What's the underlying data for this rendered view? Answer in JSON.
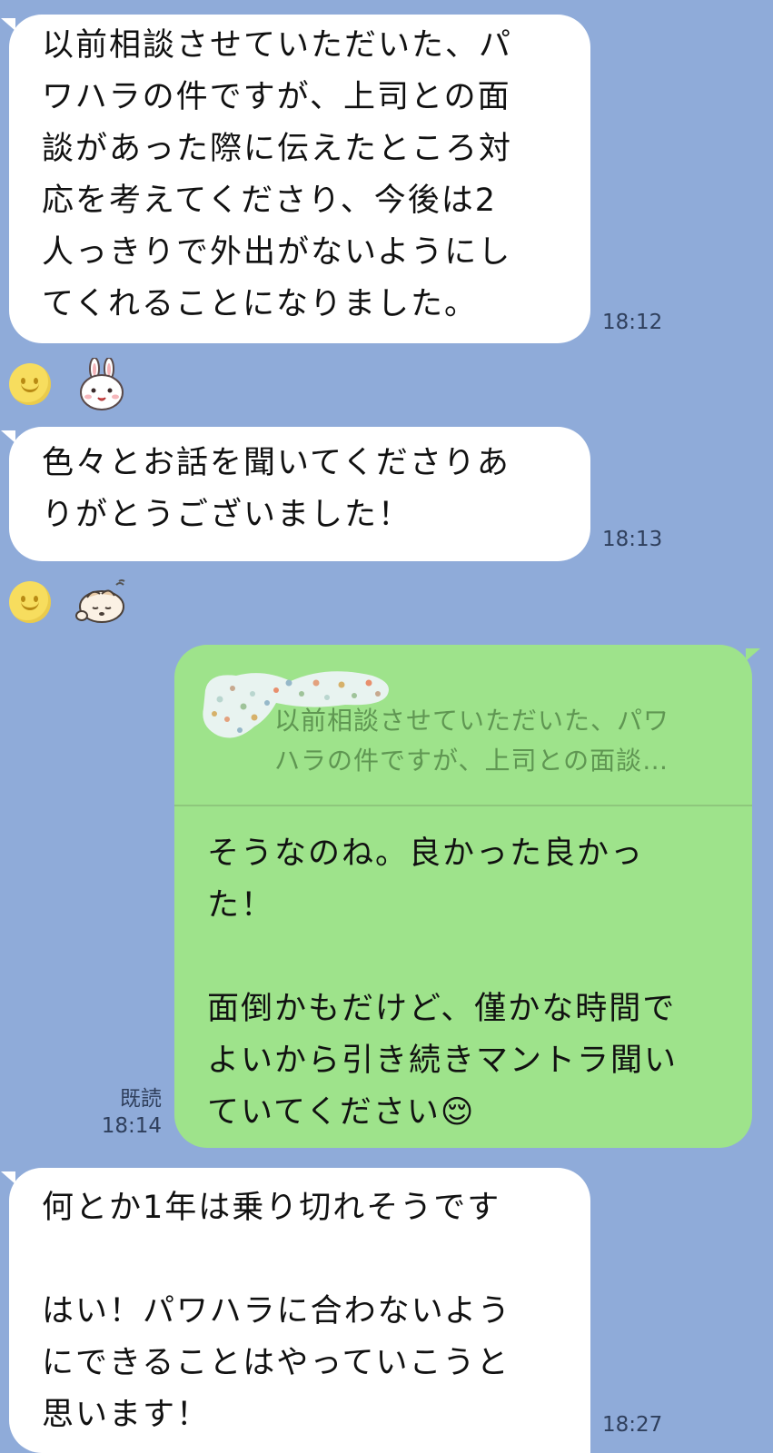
{
  "messages": [
    {
      "side": "incoming",
      "text": "以前相談させていただいた、パ\nワハラの件ですが、上司との面\n談があった際に伝えたところ対\n応を考えてくださり、今後は2\n人っきりで外出がないようにし\nてくれることになりました。",
      "time": "18:12"
    },
    {
      "side": "incoming",
      "text": "色々とお話を聞いてくださりあ\nりがとうございました！",
      "time": "18:13"
    },
    {
      "side": "outgoing",
      "quote": "以前相談させていただいた、パワ\nハラの件ですが、上司との面談…",
      "text": "そうなのね。良かった良かっ\nた！\n\n面倒かもだけど、僅かな時間で\nよいから引き続きマントラ聞い\nていてください😌",
      "read_label": "既読",
      "time": "18:14"
    },
    {
      "side": "incoming",
      "text": "何とか1年は乗り切れそうです\n\nはい！パワハラに合わないよう\nにできることはやっていこうと\n思います！",
      "time": "18:27"
    }
  ],
  "reactions": [
    {
      "icons": [
        "smile-reaction",
        "bunny-sticker-reaction"
      ]
    },
    {
      "icons": [
        "smile-reaction",
        "sleepy-creature-sticker-reaction"
      ]
    }
  ],
  "colors": {
    "background": "#8fabd9",
    "incoming_bubble": "#ffffff",
    "outgoing_bubble": "#9ee38b",
    "quote_text": "#5f9652",
    "meta_text": "#2f3f5c"
  }
}
